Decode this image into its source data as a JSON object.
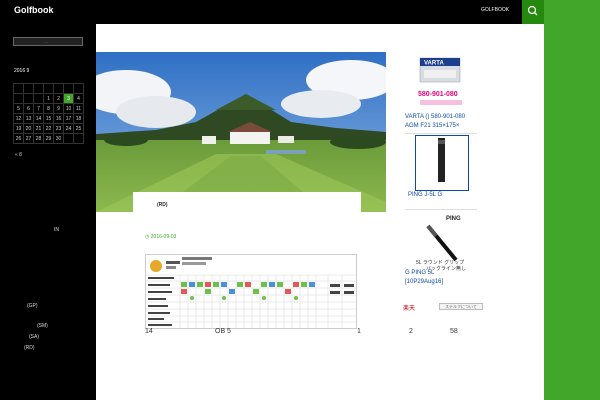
{
  "header": {
    "site_title": "Golfbook",
    "nav_item": "GOLFBOOK"
  },
  "sidebar": {
    "search_placeholder": "...",
    "month": "2016 9",
    "calendar": {
      "weekdays": [
        "",
        "",
        "",
        "",
        "",
        "",
        ""
      ],
      "rows": [
        [
          "",
          "",
          "",
          "1",
          "2",
          "3",
          "4"
        ],
        [
          "5",
          "6",
          "7",
          "8",
          "9",
          "10",
          "11"
        ],
        [
          "12",
          "13",
          "14",
          "15",
          "16",
          "17",
          "18"
        ],
        [
          "19",
          "20",
          "21",
          "22",
          "23",
          "24",
          "25"
        ],
        [
          "26",
          "27",
          "28",
          "29",
          "30",
          "",
          ""
        ]
      ],
      "today": "3",
      "prev_link": "« 8"
    },
    "texts": [
      "IN",
      "(GP)",
      "(SM)",
      "(SA)",
      "(RD)"
    ]
  },
  "post": {
    "title": "(RD)",
    "date": "2016-09-03",
    "line": [
      "14",
      "OB  5",
      "1",
      "2",
      "58"
    ]
  },
  "ads": {
    "varta_brand": "VARTA",
    "varta_phone_img": "580-901-080",
    "varta_caption": "VARTA () 580-901-080",
    "varta_model": "AGM F21 315×175×",
    "ping_caption": "PING  J-5L  G",
    "ping_logo": "PING",
    "ping_grip_text1": "5L ラウンド グリップ",
    "ping_grip_text2": "バックライン無し",
    "ping_desc": "G PING  5L",
    "ping_code": "[10P29Aug16]",
    "rakuten": "楽天",
    "ad_badge": "ステルフについて"
  },
  "colors": {
    "accent": "#41a62a",
    "accent_dark": "#24890d",
    "link": "#0b4aa8"
  }
}
